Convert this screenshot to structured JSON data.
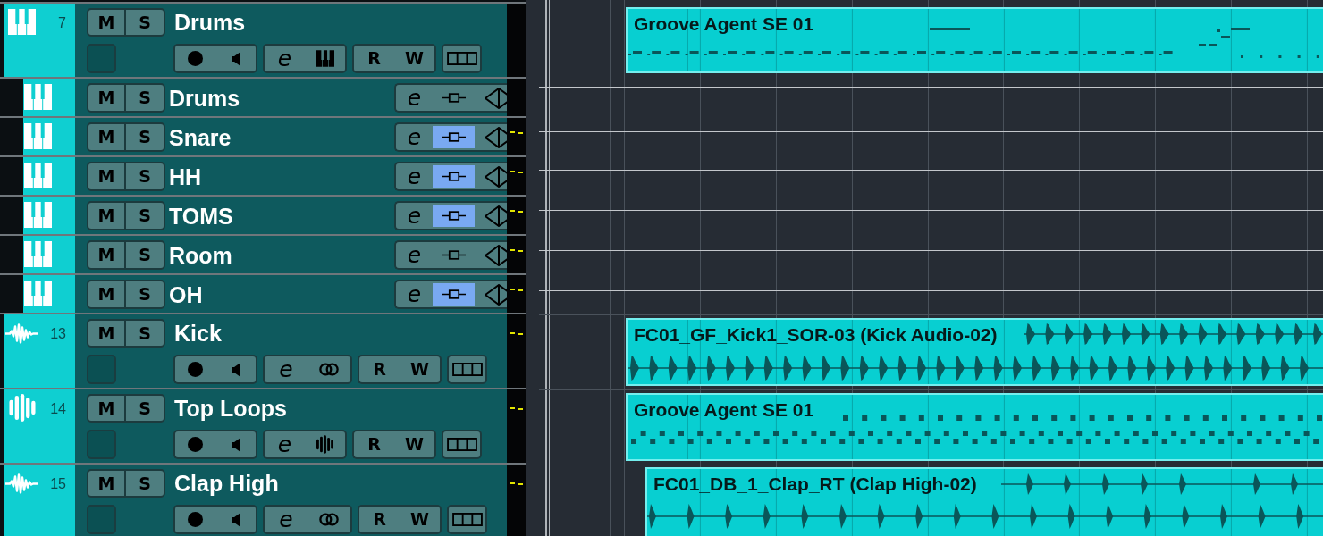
{
  "tracks": [
    {
      "kind": "instrument",
      "number": "7",
      "name": "Drums",
      "muted": false,
      "soloed": false,
      "record": false,
      "monitor": false,
      "meter_peak": false,
      "labels": {
        "mute": "M",
        "solo": "S",
        "edit": "e",
        "read": "R",
        "write": "W"
      },
      "event": {
        "kind": "midi",
        "name": "Groove Agent SE 01"
      }
    },
    {
      "kind": "output",
      "name": "Drums",
      "muted": false,
      "soloed": false,
      "fader_active": false,
      "meter_peak": false,
      "labels": {
        "mute": "M",
        "solo": "S",
        "edit": "e"
      }
    },
    {
      "kind": "output",
      "name": "Snare",
      "muted": false,
      "soloed": false,
      "fader_active": true,
      "meter_peak": true,
      "labels": {
        "mute": "M",
        "solo": "S",
        "edit": "e"
      }
    },
    {
      "kind": "output",
      "name": "HH",
      "muted": false,
      "soloed": false,
      "fader_active": true,
      "meter_peak": true,
      "labels": {
        "mute": "M",
        "solo": "S",
        "edit": "e"
      }
    },
    {
      "kind": "output",
      "name": "TOMS",
      "muted": false,
      "soloed": false,
      "fader_active": true,
      "meter_peak": true,
      "labels": {
        "mute": "M",
        "solo": "S",
        "edit": "e"
      }
    },
    {
      "kind": "output",
      "name": "Room",
      "muted": false,
      "soloed": false,
      "fader_active": false,
      "meter_peak": true,
      "labels": {
        "mute": "M",
        "solo": "S",
        "edit": "e"
      }
    },
    {
      "kind": "output",
      "name": "OH",
      "muted": false,
      "soloed": false,
      "fader_active": true,
      "meter_peak": true,
      "labels": {
        "mute": "M",
        "solo": "S",
        "edit": "e"
      }
    },
    {
      "kind": "audio",
      "number": "13",
      "name": "Kick",
      "muted": false,
      "soloed": false,
      "record": false,
      "monitor": false,
      "meter_peak": true,
      "labels": {
        "mute": "M",
        "solo": "S",
        "edit": "e",
        "read": "R",
        "write": "W"
      },
      "event": {
        "kind": "audio",
        "name": "FC01_GF_Kick1_SOR-03 (Kick Audio-02)"
      }
    },
    {
      "kind": "midi",
      "number": "14",
      "name": "Top Loops",
      "muted": false,
      "soloed": false,
      "record": false,
      "monitor": false,
      "meter_peak": true,
      "labels": {
        "mute": "M",
        "solo": "S",
        "edit": "e",
        "read": "R",
        "write": "W"
      },
      "event": {
        "kind": "midi",
        "name": "Groove Agent SE 01"
      }
    },
    {
      "kind": "audio",
      "number": "15",
      "name": "Clap High",
      "muted": false,
      "soloed": false,
      "record": false,
      "monitor": false,
      "meter_peak": true,
      "labels": {
        "mute": "M",
        "solo": "S",
        "edit": "e",
        "read": "R",
        "write": "W"
      },
      "event": {
        "kind": "audio",
        "name": "FC01_DB_1_Clap_RT (Clap High-02)"
      }
    }
  ]
}
